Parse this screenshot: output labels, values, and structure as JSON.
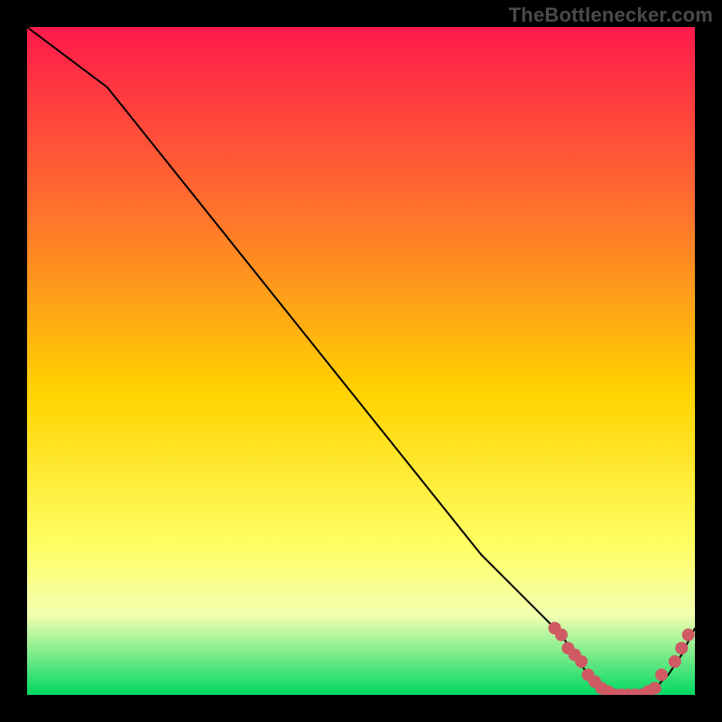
{
  "watermark": "TheBottlenecker.com",
  "colors": {
    "gradient_top": "#ff1a4b",
    "gradient_mid1": "#ff7a2a",
    "gradient_mid2": "#ffd400",
    "gradient_mid3": "#ffff66",
    "gradient_bottom": "#00d863",
    "curve": "#000000",
    "markers": "#cf5a63",
    "frame": "#000000"
  },
  "chart_data": {
    "type": "line",
    "title": "",
    "xlabel": "",
    "ylabel": "",
    "xlim": [
      0,
      100
    ],
    "ylim": [
      0,
      100
    ],
    "grid": false,
    "legend": false,
    "series": [
      {
        "name": "bottleneck-curve",
        "x": [
          0,
          4,
          8,
          12,
          16,
          20,
          24,
          28,
          32,
          36,
          40,
          44,
          48,
          52,
          56,
          60,
          64,
          68,
          72,
          76,
          80,
          82,
          84,
          86,
          88,
          90,
          92,
          94,
          96,
          98,
          100
        ],
        "y": [
          100,
          97,
          94,
          91,
          86,
          81,
          76,
          71,
          66,
          61,
          56,
          51,
          46,
          41,
          36,
          31,
          26,
          21,
          17,
          13,
          9,
          6,
          3,
          1,
          0,
          0,
          0,
          1,
          3,
          6,
          10
        ]
      }
    ],
    "markers": {
      "name": "dense-markers",
      "x": [
        79,
        80,
        81,
        82,
        83,
        84,
        85,
        86,
        87,
        88,
        89,
        90,
        91,
        92,
        93,
        94,
        95,
        97,
        98,
        99
      ],
      "y": [
        10,
        9,
        7,
        6,
        5,
        3,
        2,
        1,
        0.5,
        0,
        0,
        0,
        0,
        0,
        0.5,
        1,
        3,
        5,
        7,
        9
      ]
    }
  }
}
